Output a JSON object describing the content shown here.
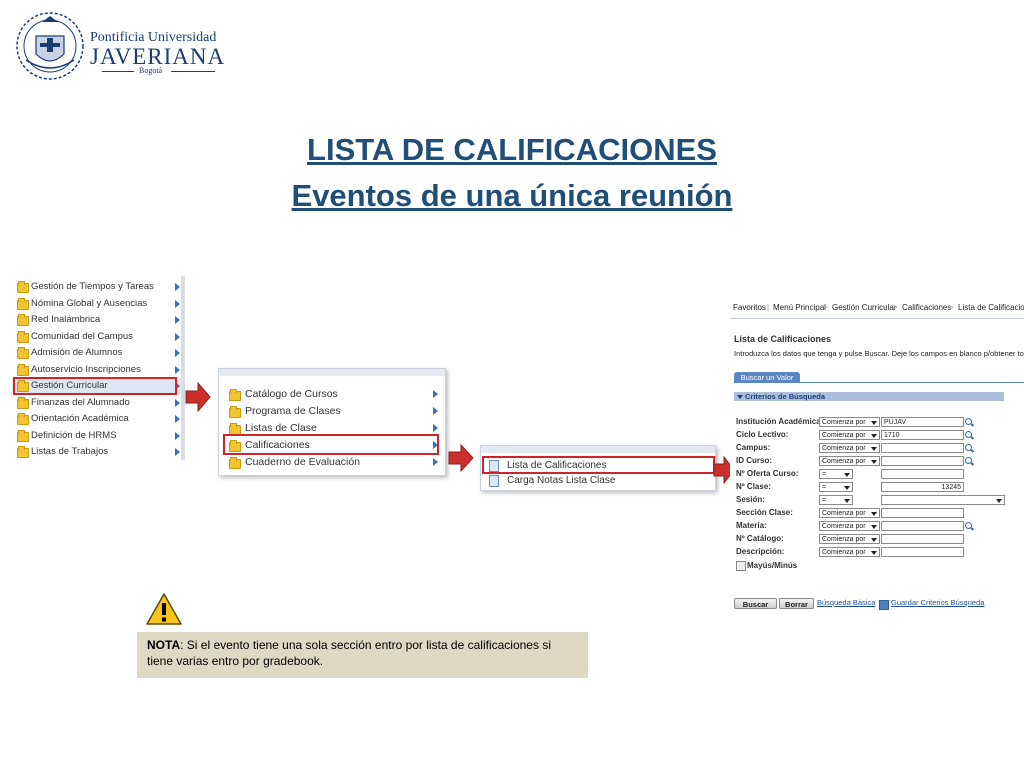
{
  "logo": {
    "line1": "Pontificia Universidad",
    "line2": "JAVERIANA",
    "line3": "Bogotá"
  },
  "title": {
    "line1": "LISTA DE CALIFICACIONES",
    "line2": "Eventos de una única reunión"
  },
  "main_menu": {
    "items": [
      {
        "label": "Gestión de Tiempos y Tareas"
      },
      {
        "label": "Nómina Global y Ausencias"
      },
      {
        "label": "Red Inalámbrica"
      },
      {
        "label": "Comunidad del Campus"
      },
      {
        "label": "Admisión de Alumnos"
      },
      {
        "label": "Autoservicio Inscripciones"
      },
      {
        "label": "Gestión Curricular",
        "selected": true
      },
      {
        "label": "Finanzas del Alumnado"
      },
      {
        "label": "Orientación Académica"
      },
      {
        "label": "Definición de HRMS"
      },
      {
        "label": "Listas de Trabajos"
      }
    ]
  },
  "submenu": {
    "items": [
      {
        "label": "Catálogo de Cursos"
      },
      {
        "label": "Programa de Clases"
      },
      {
        "label": "Listas de Clase"
      },
      {
        "label": "Calificaciones",
        "selected": true
      },
      {
        "label": "Cuaderno de Evaluación"
      }
    ]
  },
  "submenu2": {
    "items": [
      {
        "label": "Lista de Calificaciones",
        "selected": true
      },
      {
        "label": "Carga Notas Lista Clase"
      }
    ]
  },
  "form": {
    "breadcrumb": [
      "Favoritos",
      "Menú Principal",
      "Gestión Curricular",
      "Calificaciones",
      "Lista de Calificaciones"
    ],
    "page_title": "Lista de Calificaciones",
    "instructions": "Introduzca los datos que tenga y pulse Buscar. Deje los campos en blanco p/obtener todos",
    "tab_label": "Buscar un Valor",
    "section_label": "Criterios de Búsqueda",
    "fields": [
      {
        "label": "Institución Académica:",
        "operator": "Comienza por",
        "value": "PUJAV",
        "lookup": true
      },
      {
        "label": "Ciclo Lectivo:",
        "operator": "Comienza por",
        "value": "1710",
        "lookup": true
      },
      {
        "label": "Campus:",
        "operator": "Comienza por",
        "value": "",
        "lookup": true
      },
      {
        "label": "ID Curso:",
        "operator": "Comienza por",
        "value": "",
        "lookup": true
      },
      {
        "label": "Nº Oferta Curso:",
        "operator": "=",
        "value": "",
        "lookup": false
      },
      {
        "label": "Nº Clase:",
        "operator": "=",
        "value": "13245",
        "lookup": false
      },
      {
        "label": "Sesión:",
        "operator": "=",
        "value": "",
        "lookup": false
      },
      {
        "label": "Sección Clase:",
        "operator": "Comienza por",
        "value": "",
        "lookup": false
      },
      {
        "label": "Materia:",
        "operator": "Comienza por",
        "value": "",
        "lookup": true
      },
      {
        "label": "Nº Catálogo:",
        "operator": "Comienza por",
        "value": "",
        "lookup": false
      },
      {
        "label": "Descripción:",
        "operator": "Comienza por",
        "value": "",
        "lookup": false
      }
    ],
    "case_checkbox_label": "Mayús/Minús",
    "search_button": "Buscar",
    "clear_button": "Borrar",
    "basic_search_link": "Búsqueda Básica",
    "save_criteria_link": "Guardar Criterios Búsqueda"
  },
  "note": {
    "bold": "NOTA",
    "text": ": Si el evento tiene una sola sección entro por lista de calificaciones si tiene varias entro por gradebook."
  },
  "colors": {
    "title": "#1f4e79",
    "highlight": "#d3232a",
    "note_bg": "#ddd9c3",
    "folder": "#f2c430",
    "tab": "#5a86c2"
  }
}
